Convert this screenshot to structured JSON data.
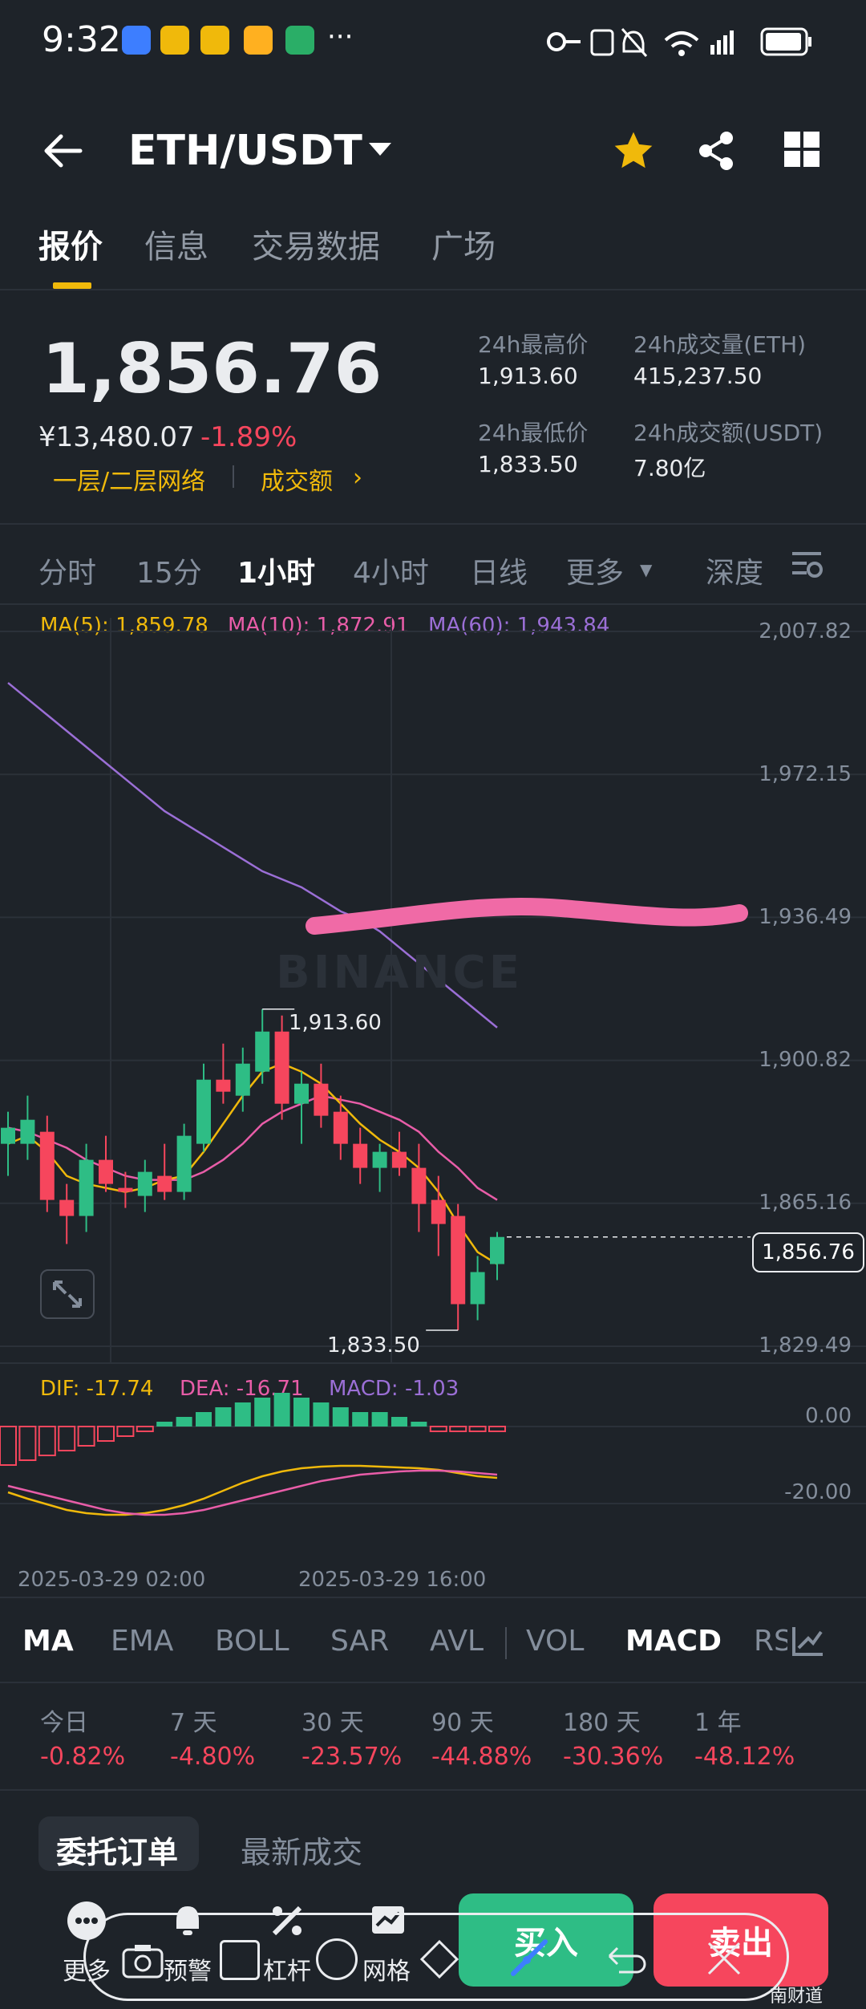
{
  "status_bar": {
    "time": "9:32",
    "ellipsis": "···",
    "icons_right": "6 4G"
  },
  "header": {
    "pair": "ETH/USDT"
  },
  "tabs": [
    {
      "label": "报价"
    },
    {
      "label": "信息"
    },
    {
      "label": "交易数据"
    },
    {
      "label": "广场"
    }
  ],
  "ticker": {
    "price": "1,856.76",
    "cny": "¥13,480.07",
    "change": "-1.89%",
    "network_link": "一层/二层网络",
    "turnover_link": "成交额",
    "high_label": "24h最高价",
    "high": "1,913.60",
    "low_label": "24h最低价",
    "low": "1,833.50",
    "vol_eth_label": "24h成交量(ETH)",
    "vol_eth": "415,237.50",
    "vol_usdt_label": "24h成交额(USDT)",
    "vol_usdt": "7.80亿"
  },
  "intervals": [
    "分时",
    "15分",
    "1小时",
    "4小时",
    "日线",
    "更多",
    "深度"
  ],
  "ma_legend": {
    "ma5": "MA(5): 1,859.78",
    "ma10": "MA(10): 1,872.91",
    "ma60": "MA(60): 1,943.84"
  },
  "watermark": "BINANCE",
  "chart_data": {
    "type": "candlestick",
    "interval": "1小时",
    "y_ticks": [
      "2,007.82",
      "1,972.15",
      "1,936.49",
      "1,900.82",
      "1,865.16",
      "1,829.49"
    ],
    "ylim": [
      1829.49,
      2007.82
    ],
    "high_label": "1,913.60",
    "low_label": "1,833.50",
    "last_price": "1,856.76",
    "candles": [
      {
        "o": 1880,
        "h": 1888,
        "l": 1872,
        "c": 1884
      },
      {
        "o": 1880,
        "h": 1892,
        "l": 1876,
        "c": 1886
      },
      {
        "o": 1883,
        "h": 1887,
        "l": 1863,
        "c": 1866
      },
      {
        "o": 1866,
        "h": 1870,
        "l": 1855,
        "c": 1862
      },
      {
        "o": 1862,
        "h": 1880,
        "l": 1858,
        "c": 1876
      },
      {
        "o": 1876,
        "h": 1882,
        "l": 1868,
        "c": 1870
      },
      {
        "o": 1869,
        "h": 1873,
        "l": 1864,
        "c": 1868
      },
      {
        "o": 1867,
        "h": 1876,
        "l": 1863,
        "c": 1873
      },
      {
        "o": 1872,
        "h": 1880,
        "l": 1866,
        "c": 1868
      },
      {
        "o": 1868,
        "h": 1885,
        "l": 1866,
        "c": 1882
      },
      {
        "o": 1880,
        "h": 1900,
        "l": 1878,
        "c": 1896
      },
      {
        "o": 1896,
        "h": 1905,
        "l": 1890,
        "c": 1893
      },
      {
        "o": 1892,
        "h": 1904,
        "l": 1888,
        "c": 1900
      },
      {
        "o": 1898,
        "h": 1913.6,
        "l": 1895,
        "c": 1908
      },
      {
        "o": 1908,
        "h": 1912,
        "l": 1886,
        "c": 1890
      },
      {
        "o": 1890,
        "h": 1898,
        "l": 1880,
        "c": 1895
      },
      {
        "o": 1895,
        "h": 1900,
        "l": 1884,
        "c": 1887
      },
      {
        "o": 1888,
        "h": 1892,
        "l": 1876,
        "c": 1880
      },
      {
        "o": 1880,
        "h": 1884,
        "l": 1870,
        "c": 1874
      },
      {
        "o": 1874,
        "h": 1880,
        "l": 1868,
        "c": 1878
      },
      {
        "o": 1878,
        "h": 1883,
        "l": 1872,
        "c": 1874
      },
      {
        "o": 1874,
        "h": 1880,
        "l": 1858,
        "c": 1865
      },
      {
        "o": 1866,
        "h": 1872,
        "l": 1852,
        "c": 1860
      },
      {
        "o": 1862,
        "h": 1865,
        "l": 1833.5,
        "c": 1840
      },
      {
        "o": 1840,
        "h": 1852,
        "l": 1836,
        "c": 1848
      },
      {
        "o": 1850,
        "h": 1858,
        "l": 1846,
        "c": 1856.76
      }
    ],
    "ma5": [
      1880,
      1882,
      1878,
      1872,
      1870,
      1869,
      1868,
      1869,
      1871,
      1872,
      1878,
      1885,
      1892,
      1898,
      1900,
      1898,
      1895,
      1890,
      1885,
      1881,
      1878,
      1874,
      1868,
      1860,
      1853,
      1850
    ],
    "ma10": [
      1884,
      1883,
      1881,
      1879,
      1876,
      1874,
      1872,
      1871,
      1871,
      1871,
      1873,
      1876,
      1880,
      1885,
      1888,
      1890,
      1892,
      1891,
      1890,
      1888,
      1886,
      1883,
      1878,
      1874,
      1869,
      1866
    ],
    "ma60": [
      1995,
      1991,
      1987,
      1983,
      1979,
      1975,
      1971,
      1967,
      1963,
      1960,
      1957,
      1954,
      1951,
      1948,
      1946,
      1944,
      1941,
      1938,
      1936,
      1933,
      1929,
      1925,
      1921,
      1917,
      1913,
      1909
    ],
    "macd_legend": {
      "dif": "DIF: -17.74",
      "dea": "DEA: -16.71",
      "macd": "MACD: -1.03"
    },
    "macd_y_ticks": [
      "0.00",
      "-20.00"
    ],
    "macd_hist": [
      -8,
      -7,
      -6,
      -5,
      -4,
      -3,
      -2,
      -1,
      1,
      2,
      3,
      4,
      5,
      6,
      7,
      6,
      5,
      4,
      3,
      3,
      2,
      1,
      -1,
      -1,
      -1,
      -1
    ],
    "x_ticks": [
      "2025-03-29 02:00",
      "2025-03-29 16:00"
    ]
  },
  "indicators": [
    "MA",
    "EMA",
    "BOLL",
    "SAR",
    "AVL",
    "VOL",
    "MACD",
    "RS"
  ],
  "performance": [
    {
      "label": "今日",
      "value": "-0.82%"
    },
    {
      "label": "7 天",
      "value": "-4.80%"
    },
    {
      "label": "30 天",
      "value": "-23.57%"
    },
    {
      "label": "90 天",
      "value": "-44.88%"
    },
    {
      "label": "180 天",
      "value": "-30.36%"
    },
    {
      "label": "1 年",
      "value": "-48.12%"
    }
  ],
  "order_tabs": [
    "委托订单",
    "最新成交"
  ],
  "bottom_nav": [
    "更多",
    "预警",
    "杠杆",
    "网格"
  ],
  "buttons": {
    "buy": "买入",
    "sell": "卖出"
  },
  "watermark_footer": "南财道",
  "colors": {
    "up": "#2ebd85",
    "down": "#f6465d",
    "accent": "#f0b90b",
    "ma5": "#f0b90b",
    "ma10": "#e85da8",
    "ma60": "#9b6fd6",
    "bg": "#1e2329"
  }
}
